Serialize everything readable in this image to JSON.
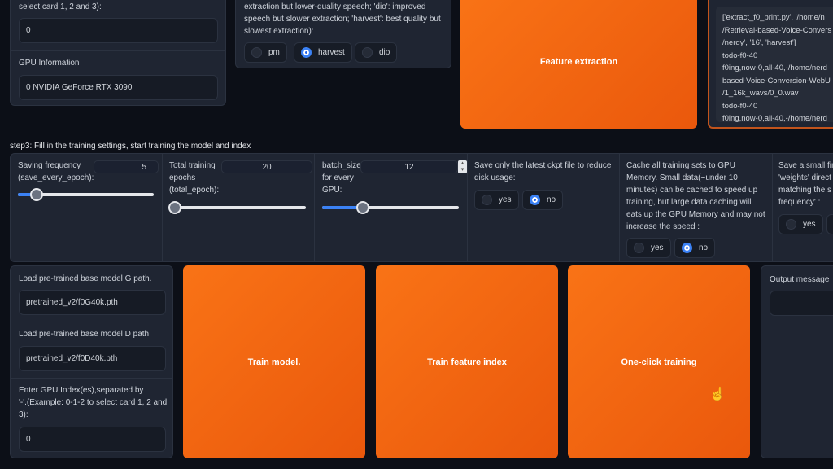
{
  "gpu_panel": {
    "index_label_tail": "select card 1, 2 and 3):",
    "index_value": "0",
    "info_label": "GPU Information",
    "info_value": "0 NVIDIA GeForce RTX 3090"
  },
  "f0_panel": {
    "desc_lines": [
      "extraction but lower-quality speech; 'dio': improved",
      "speech but slower extraction; 'harvest': best quality but",
      "slowest extraction):"
    ],
    "options": [
      {
        "label": "pm",
        "selected": false
      },
      {
        "label": "harvest",
        "selected": true
      },
      {
        "label": "dio",
        "selected": false
      }
    ]
  },
  "feature_extraction_button": "Feature extraction",
  "extract_output_lines": [
    "['extract_f0_print.py', '/home/n",
    "/Retrieval-based-Voice-Convers",
    "/nerdy', '16', 'harvest']",
    "todo-f0-40",
    "f0ing,now-0,all-40,-/home/nerd",
    "based-Voice-Conversion-WebU",
    "/1_16k_wavs/0_0.wav",
    "todo-f0-40",
    "f0ing,now-0,all-40,-/home/nerd"
  ],
  "step3_title": "step3: Fill in the training settings, start training the model and index",
  "settings": {
    "save_freq": {
      "label_lines": [
        "Saving frequency",
        "(save_every_epoch):"
      ],
      "value": "5",
      "slider_fraction": 0.14
    },
    "total_epoch": {
      "label_lines": [
        "Total training",
        "epochs",
        "(total_epoch):"
      ],
      "value": "20",
      "slider_fraction": 0.03
    },
    "batch_size": {
      "label_lines": [
        "batch_size",
        "for every",
        "GPU:"
      ],
      "value": "12",
      "slider_fraction": 0.3
    },
    "save_latest": {
      "label_lines": [
        "Save only the latest ckpt file to reduce",
        "disk usage:"
      ],
      "options": [
        {
          "label": "yes",
          "selected": false
        },
        {
          "label": "no",
          "selected": true
        }
      ]
    },
    "cache_gpu": {
      "label_lines": [
        "Cache all training sets to GPU",
        "Memory. Small data(~under 10",
        "minutes) can be cached to speed up",
        "training, but large data caching will",
        "eats up the GPU Memory and may not",
        "increase the speed :"
      ],
      "options": [
        {
          "label": "yes",
          "selected": false
        },
        {
          "label": "no",
          "selected": true
        }
      ]
    },
    "save_small": {
      "label_lines": [
        "Save a small fin",
        "'weights' direct",
        "matching the s",
        "frequency' :"
      ],
      "options": [
        {
          "label": "yes",
          "selected": false
        }
      ]
    }
  },
  "pretrained": {
    "g_label": "Load pre-trained base model G path.",
    "g_value": "pretrained_v2/f0G40k.pth",
    "d_label": "Load pre-trained base model D path.",
    "d_value": "pretrained_v2/f0D40k.pth",
    "gpu_label_lines": [
      "Enter GPU Index(es),separated by",
      "'-'.(Example: 0-1-2 to select card 1, 2 and",
      "3):"
    ],
    "gpu_value": "0"
  },
  "buttons": {
    "train_model": "Train model.",
    "train_index": "Train feature index",
    "one_click": "One-click training"
  },
  "output_message_label": "Output message",
  "colors": {
    "accent": "#f97316",
    "radio": "#3b82f6",
    "panel": "#1f2532"
  }
}
